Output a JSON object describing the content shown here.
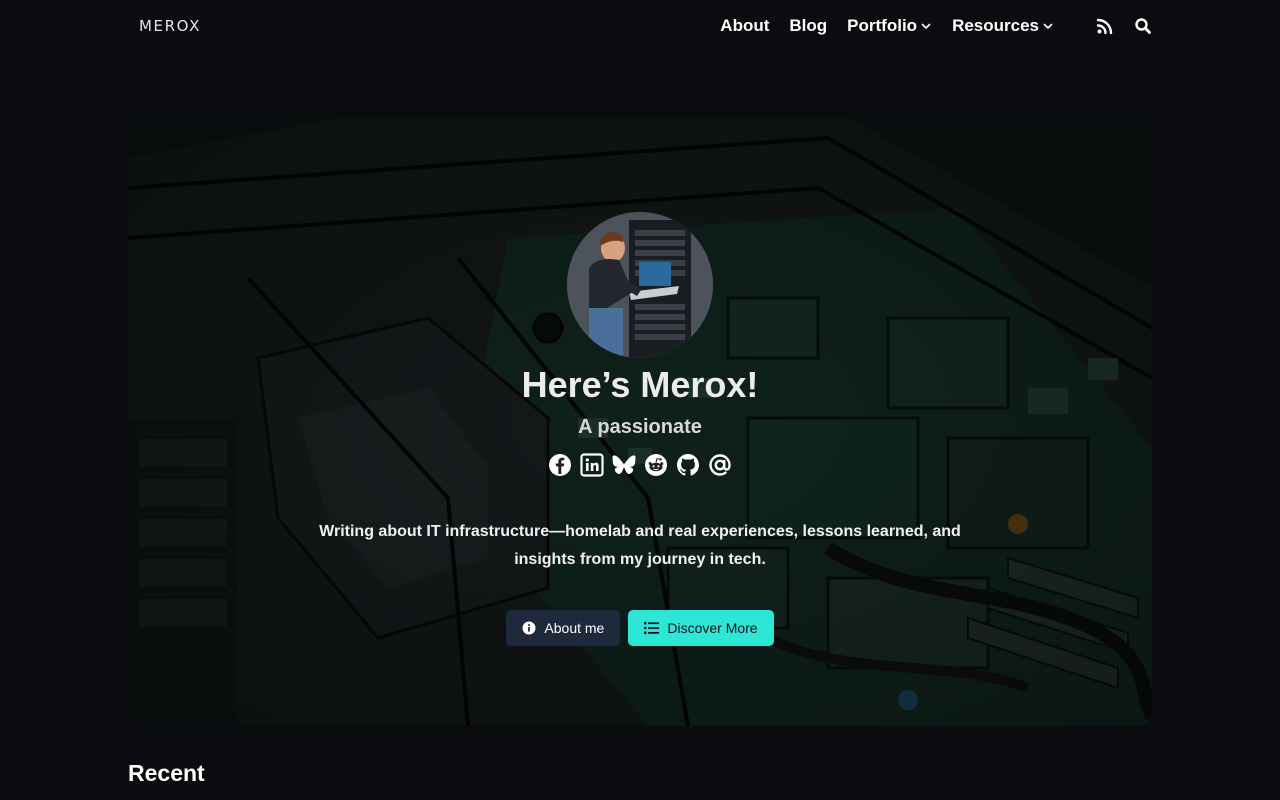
{
  "site": {
    "logo": "MEROX"
  },
  "nav": {
    "about": "About",
    "blog": "Blog",
    "portfolio": "Portfolio",
    "resources": "Resources",
    "icons": [
      "rss-icon",
      "search-icon"
    ]
  },
  "hero": {
    "title": "Here’s Merox!",
    "subtitle": "A passionate",
    "social_icons": [
      "facebook-icon",
      "linkedin-icon",
      "bluesky-icon",
      "reddit-icon",
      "github-icon",
      "email-icon"
    ],
    "description": "Writing about IT infrastructure—homelab and real experiences, lessons learned, and insights from my journey in tech.",
    "buttons": {
      "about_me": "About me",
      "discover": "Discover More"
    }
  },
  "sections": {
    "recent": "Recent"
  },
  "colors": {
    "background": "#0b0c0f",
    "accent": "#2ee6d6",
    "dark_button": "#1e293b"
  }
}
